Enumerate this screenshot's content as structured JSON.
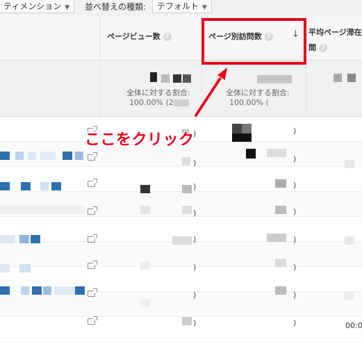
{
  "toolbar": {
    "dimension_label": "ティメンション",
    "sort_type_label": "並べ替えの種類:",
    "sort_type_value": "テフォルト"
  },
  "table": {
    "columns": [
      {
        "label": "ページビュー数"
      },
      {
        "label": "ページ別訪問数",
        "sorted": true
      },
      {
        "label_line1": "平均ページ滞在",
        "label_line2": "間"
      }
    ],
    "summary": {
      "pageviews": {
        "share_label": "全体に対する割合:",
        "share_value": "100.00% (2"
      },
      "unique": {
        "share_label": "全体に対する割合:",
        "share_value": "100.00% ("
      }
    },
    "time_value": "00:0"
  },
  "annotation": {
    "callout_text": "ここをクリック",
    "highlight_color": "#e8001c"
  },
  "icons": {
    "help": "help-circle-icon",
    "sort": "arrow-down-icon",
    "external": "open-in-new-icon",
    "dropdown": "caret-down-icon"
  }
}
